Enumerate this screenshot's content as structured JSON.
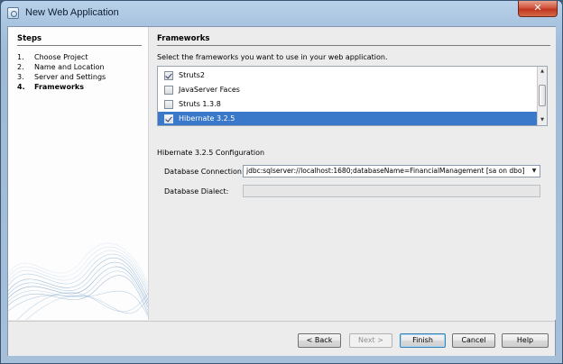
{
  "window": {
    "title": "New Web Application",
    "close_glyph": "✕"
  },
  "steps": {
    "heading": "Steps",
    "items": [
      {
        "num": "1.",
        "label": "Choose Project",
        "current": false
      },
      {
        "num": "2.",
        "label": "Name and Location",
        "current": false
      },
      {
        "num": "3.",
        "label": "Server and Settings",
        "current": false
      },
      {
        "num": "4.",
        "label": "Frameworks",
        "current": true
      }
    ]
  },
  "frameworks": {
    "heading": "Frameworks",
    "instruction": "Select the frameworks you want to use in your web application.",
    "items": [
      {
        "label": "Struts2",
        "checked": true,
        "selected": false
      },
      {
        "label": "JavaServer Faces",
        "checked": false,
        "selected": false
      },
      {
        "label": "Struts 1.3.8",
        "checked": false,
        "selected": false
      },
      {
        "label": "Hibernate 3.2.5",
        "checked": true,
        "selected": true
      }
    ]
  },
  "config": {
    "title": "Hibernate 3.2.5 Configuration",
    "db_connection_label": "Database Connection:",
    "db_connection_value": "jdbc:sqlserver://localhost:1680;databaseName=FinancialManagement [sa on dbo]",
    "db_dialect_label": "Database Dialect:",
    "db_dialect_value": ""
  },
  "buttons": {
    "back": "< Back",
    "next": "Next >",
    "finish": "Finish",
    "cancel": "Cancel",
    "help": "Help"
  },
  "icons": {
    "checkbox_checked": "check-icon",
    "dropdown": "chevron-down-icon",
    "scroll_up": "triangle-up-icon",
    "scroll_down": "triangle-down-icon"
  },
  "colors": {
    "selection": "#3a78c9",
    "close_button": "#c0361f"
  }
}
